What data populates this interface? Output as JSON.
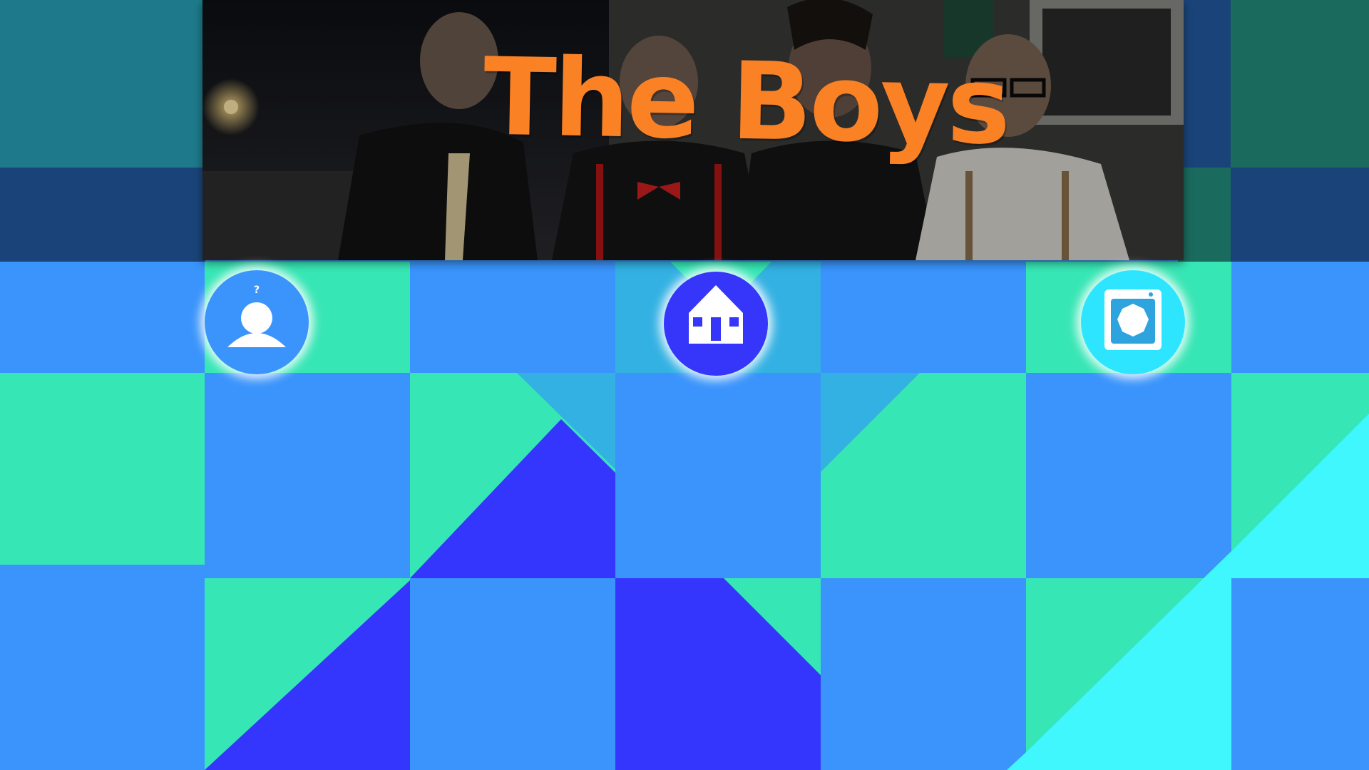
{
  "banner": {
    "title": "The Boys",
    "title_color": "#fb8125"
  },
  "nav": {
    "profile": {
      "icon": "profile-icon",
      "color": "#3a94fb"
    },
    "home": {
      "icon": "home-icon",
      "color": "#3536f9"
    },
    "camera": {
      "icon": "camera-icon",
      "color": "#2ee5ff"
    }
  },
  "colors": {
    "blue": "#3a94fb",
    "mint": "#37e6b5",
    "indigo": "#3536fd",
    "cyan": "#3ff7fd",
    "sky": "#33b1e3",
    "teal_dark": "#1e7a8a",
    "navy": "#1a4479",
    "forest": "#1a6b5e"
  }
}
